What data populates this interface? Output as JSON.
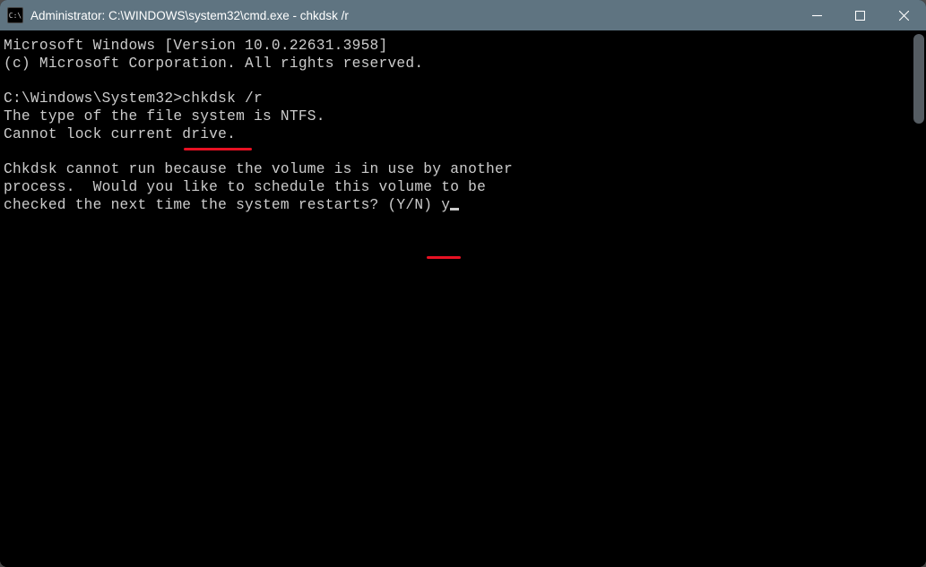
{
  "titlebar": {
    "icon_label": "C:\\",
    "title": "Administrator: C:\\WINDOWS\\system32\\cmd.exe - chkdsk  /r"
  },
  "terminal": {
    "line1": "Microsoft Windows [Version 10.0.22631.3958]",
    "line2": "(c) Microsoft Corporation. All rights reserved.",
    "blank1": "",
    "prompt": "C:\\Windows\\System32>",
    "command": "chkdsk /r",
    "out1": "The type of the file system is NTFS.",
    "out2": "Cannot lock current drive.",
    "blank2": "",
    "out3": "Chkdsk cannot run because the volume is in use by another",
    "out4": "process.  Would you like to schedule this volume to be",
    "out5": "checked the next time the system restarts? (Y/N) ",
    "input": "y"
  }
}
